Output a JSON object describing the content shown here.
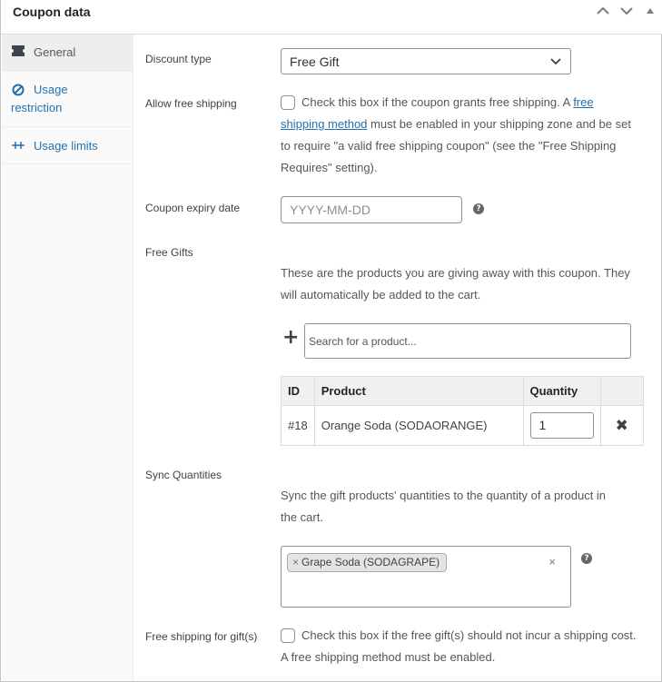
{
  "header": {
    "title": "Coupon data"
  },
  "tabs": [
    {
      "label": "General",
      "icon": "ticket-icon"
    },
    {
      "label_line1": "Usage",
      "label_line2": "restriction",
      "icon": "block-icon"
    },
    {
      "label": "Usage limits",
      "icon": "limits-icon"
    }
  ],
  "fields": {
    "discount_type": {
      "label": "Discount type",
      "value": "Free Gift"
    },
    "free_shipping": {
      "label": "Allow free shipping",
      "line1_pre": "Check this box if the coupon grants free shipping. A ",
      "link_part1": "free",
      "link_part2": "shipping method",
      "line2_post": " must be enabled in your shipping zone and be set",
      "line3": "to require \"a valid free shipping coupon\" (see the \"Free Shipping",
      "line4": "Requires\" setting)."
    },
    "expiry": {
      "label": "Coupon expiry date",
      "placeholder": "YYYY-MM-DD"
    },
    "free_gifts": {
      "label": "Free Gifts",
      "desc_line1": "These are the products you are giving away with this coupon. They",
      "desc_line2": "will automatically be added to the cart.",
      "search_placeholder": "Search for a product...",
      "table": {
        "headers": {
          "id": "ID",
          "product": "Product",
          "quantity": "Quantity"
        },
        "rows": [
          {
            "id": "#18",
            "product": "Orange Soda (SODAORANGE)",
            "quantity": "1"
          }
        ]
      }
    },
    "sync": {
      "label": "Sync Quantities",
      "desc_line1": "Sync the gift products' quantities to the quantity of a product in",
      "desc_line2": "the cart.",
      "selected": "Grape Soda (SODAGRAPE)",
      "chip_remove": "×",
      "clear": "×"
    },
    "free_shipping_gifts": {
      "label": "Free shipping for gift(s)",
      "line1": "Check this box if the free gift(s) should not incur a shipping cost.",
      "line2": "A free shipping method must be enabled."
    }
  },
  "help_glyph": "?",
  "plus_glyph": "+",
  "remove_glyph": "✖"
}
